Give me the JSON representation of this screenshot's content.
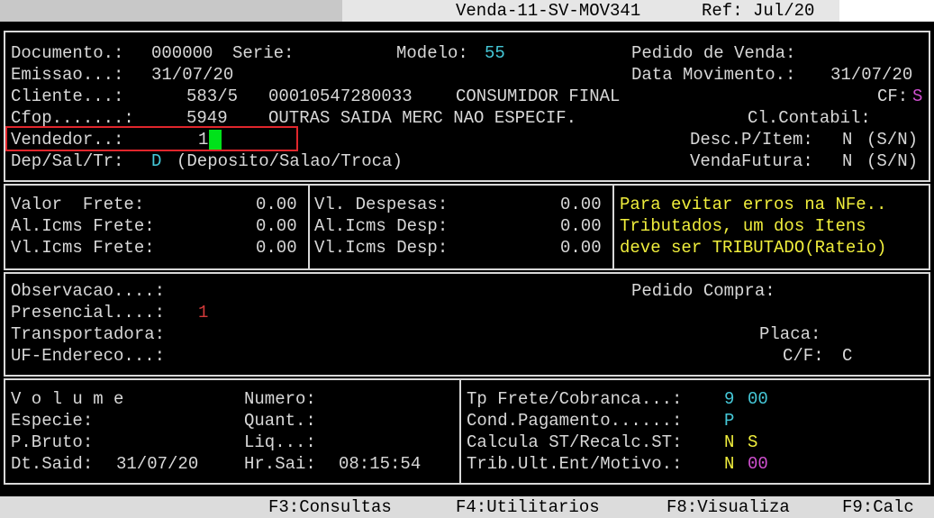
{
  "titlebar": {
    "title": "Venda-11-SV-MOV341",
    "ref": "Ref: Jul/20"
  },
  "header": {
    "documento_label": "Documento.:",
    "documento_value": "000000",
    "serie_label": "Serie:",
    "modelo_label": "Modelo:",
    "modelo_value": "55",
    "pedido_venda_label": "Pedido de Venda:",
    "emissao_label": "Emissao...:",
    "emissao_value": "31/07/20",
    "data_mov_label": "Data Movimento.:",
    "data_mov_value": "31/07/20",
    "cliente_label": "Cliente...:",
    "cliente_code": "583/5",
    "cliente_doc": "00010547280033",
    "cliente_name": "CONSUMIDOR FINAL",
    "cf_label": "CF:",
    "cf_value": "S",
    "cfop_label": "Cfop.......:",
    "cfop_code": "5949",
    "cfop_desc": "OUTRAS SAIDA MERC NAO ESPECIF.",
    "cl_contabil_label": "Cl.Contabil:",
    "vendedor_label": "Vendedor..:",
    "vendedor_value": "1",
    "desc_item_label": "Desc.P/Item:",
    "desc_item_value": "N",
    "desc_item_opts": "(S/N)",
    "dep_label": "Dep/Sal/Tr:",
    "dep_value": "D",
    "dep_desc": "(Deposito/Salao/Troca)",
    "venda_futura_label": "VendaFutura:",
    "venda_futura_value": "N",
    "venda_futura_opts": "(S/N)"
  },
  "freight": {
    "valor_frete_label": "Valor  Frete:",
    "valor_frete_value": "0.00",
    "al_icms_frete_label": "Al.Icms Frete:",
    "al_icms_frete_value": "0.00",
    "vl_icms_frete_label": "Vl.Icms Frete:",
    "vl_icms_frete_value": "0.00",
    "vl_despesas_label": "Vl. Despesas:",
    "vl_despesas_value": "0.00",
    "al_icms_desp_label": "Al.Icms Desp:",
    "al_icms_desp_value": "0.00",
    "vl_icms_desp_label": "Vl.Icms Desp:",
    "vl_icms_desp_value": "0.00",
    "notice_1": "Para evitar erros na NFe..",
    "notice_2": "Tributados, um dos Itens",
    "notice_3": "deve ser TRIBUTADO(Rateio)"
  },
  "obs": {
    "observacao_label": "Observacao....:",
    "pedido_compra_label": "Pedido Compra:",
    "presencial_label": "Presencial....:",
    "presencial_value": "1",
    "transportadora_label": "Transportadora:",
    "placa_label": "Placa:",
    "uf_label": "UF-Endereco...:",
    "cf_label": "C/F:",
    "cf_value": "C"
  },
  "volume": {
    "volume_label": "V o l u m e",
    "numero_label": "Numero:",
    "especie_label": "Especie:",
    "quant_label": "Quant.:",
    "pbruto_label": "P.Bruto:",
    "liq_label": "Liq...:",
    "dtsaid_label": "Dt.Said:",
    "dtsaid_value": "31/07/20",
    "hrsai_label": "Hr.Sai:",
    "hrsai_value": "08:15:54"
  },
  "payment": {
    "tp_frete_label": "Tp Frete/Cobranca...:",
    "tp_frete_v1": "9",
    "tp_frete_v2": "00",
    "cond_pag_label": "Cond.Pagamento......:",
    "cond_pag_value": "P",
    "calcula_st_label": "Calcula ST/Recalc.ST:",
    "calcula_st_v1": "N",
    "calcula_st_v2": "S",
    "trib_label": "Trib.Ult.Ent/Motivo.:",
    "trib_v1": "N",
    "trib_v2": "00"
  },
  "statusbar": {
    "f3": "F3:Consultas",
    "f4": "F4:Utilitarios",
    "f8": "F8:Visualiza",
    "f9": "F9:Calc"
  }
}
